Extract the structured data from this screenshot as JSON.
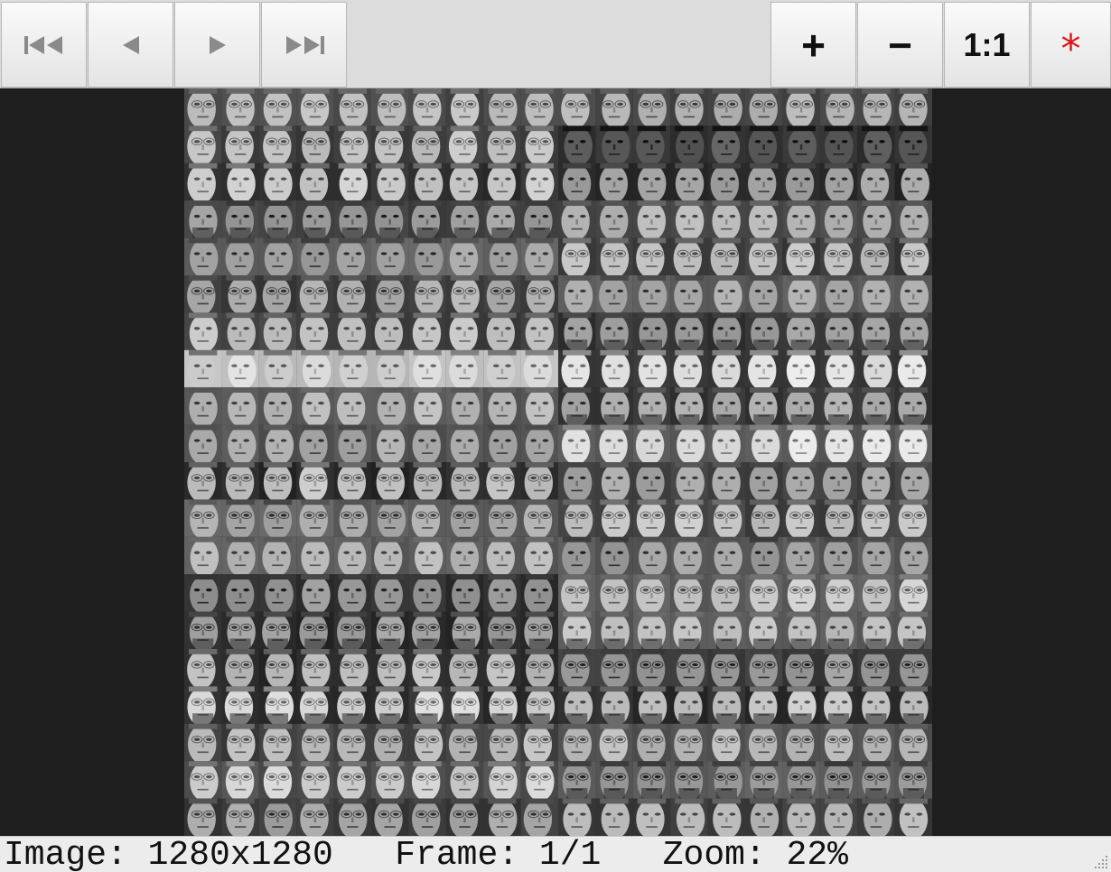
{
  "toolbar": {
    "nav_buttons": [
      {
        "name": "first-frame-button",
        "icon": "skip-to-start-icon"
      },
      {
        "name": "previous-frame-button",
        "icon": "triangle-left-icon"
      },
      {
        "name": "next-frame-button",
        "icon": "triangle-right-icon"
      },
      {
        "name": "last-frame-button",
        "icon": "skip-to-end-icon"
      }
    ],
    "zoom_in_label": "+",
    "zoom_out_label": "−",
    "actual_size_label": "1:1",
    "reset_label": "*",
    "reset_color": "#e0161b",
    "icon_color": "#8a8a8a"
  },
  "image": {
    "description_icon": "face-mosaic-image",
    "grid_columns": 20,
    "grid_rows": 20
  },
  "status": {
    "text": "Image: 1280x1280   Frame: 1/1   Zoom: 22%"
  }
}
